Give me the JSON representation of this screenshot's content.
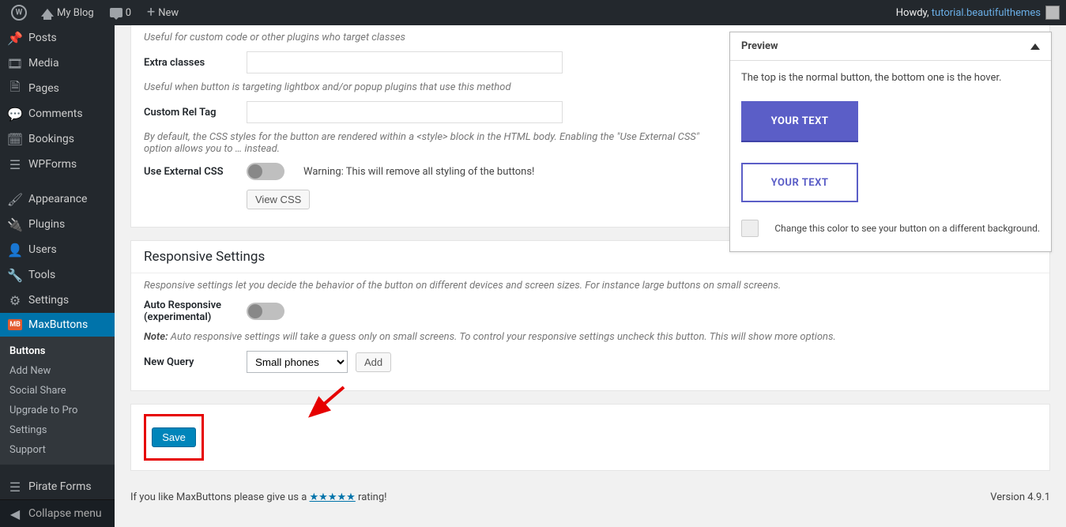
{
  "toolbar": {
    "site_name": "My Blog",
    "comments_count": "0",
    "new_label": "New",
    "howdy_prefix": "Howdy, ",
    "howdy_user": "tutorial.beautifulthemes"
  },
  "sidebar": {
    "items": [
      {
        "label": "Posts",
        "icon": "📌"
      },
      {
        "label": "Media",
        "icon": "🖼"
      },
      {
        "label": "Pages",
        "icon": "🗎"
      },
      {
        "label": "Comments",
        "icon": "💬"
      },
      {
        "label": "Bookings",
        "icon": "🗓"
      },
      {
        "label": "WPForms",
        "icon": "☰"
      },
      {
        "label": "Appearance",
        "icon": "🖌"
      },
      {
        "label": "Plugins",
        "icon": "🔌"
      },
      {
        "label": "Users",
        "icon": "👤"
      },
      {
        "label": "Tools",
        "icon": "🔧"
      },
      {
        "label": "Settings",
        "icon": "⚙"
      },
      {
        "label": "MaxButtons",
        "icon": "MB"
      }
    ],
    "submenu": [
      "Buttons",
      "Add New",
      "Social Share",
      "Upgrade to Pro",
      "Settings",
      "Support"
    ],
    "pirate_label": "Pirate Forms",
    "collapse_label": "Collapse menu"
  },
  "panel1": {
    "desc_top": "Useful for custom code or other plugins who target classes",
    "extra_classes_label": "Extra classes",
    "desc_rel": "Useful when button is targeting lightbox and/or popup plugins that use this method",
    "custom_rel_label": "Custom Rel Tag",
    "desc_css": "By default, the CSS styles for the button are rendered within a <style> block in the HTML body. Enabling the \"Use External CSS\" option allows you to … instead.",
    "use_external_label": "Use External CSS",
    "use_external_warning": "Warning: This will remove all styling of the buttons!",
    "view_css_label": "View CSS"
  },
  "panel2": {
    "title": "Responsive Settings",
    "desc": "Responsive settings let you decide the behavior of the button on different devices and screen sizes. For instance large buttons on small screens.",
    "auto_responsive_label_1": "Auto Responsive",
    "auto_responsive_label_2": "(experimental)",
    "note_label": "Note:",
    "note_text": " Auto responsive settings will take a guess only on small screens. To control your responsive settings uncheck this button. This will show more options.",
    "new_query_label": "New Query",
    "new_query_value": "Small phones",
    "add_label": "Add"
  },
  "save_label": "Save",
  "footer": {
    "like_text_a": "If you like MaxButtons please give us a ",
    "stars": "★★★★★",
    "like_text_b": " rating!",
    "version": "Version 4.9.1"
  },
  "preview": {
    "title": "Preview",
    "hint_top": "The top is the normal button, the bottom one is the hover.",
    "btn_text": "YOUR TEXT",
    "hint_color": "Change this color to see your button on a different background."
  }
}
